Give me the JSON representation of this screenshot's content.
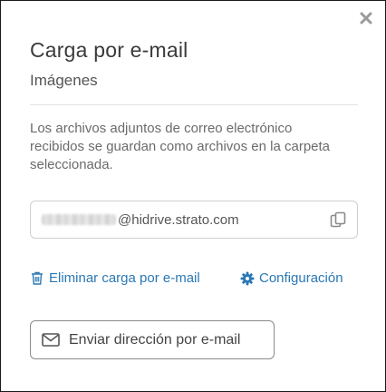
{
  "dialog": {
    "title": "Carga por e-mail",
    "subtitle": "Imágenes",
    "description": "Los archivos adjuntos de correo electrónico recibidos se guardan como archivos en la carpeta seleccionada.",
    "close_icon": "close-icon"
  },
  "email": {
    "domain": "@hidrive.strato.com",
    "copy_icon": "copy-icon"
  },
  "actions": {
    "delete_label": "Eliminar carga por e-mail",
    "delete_icon": "trash-icon",
    "config_label": "Configuración",
    "config_icon": "gear-icon"
  },
  "send_button": {
    "label": "Enviar dirección por e-mail",
    "icon": "envelope-icon"
  },
  "colors": {
    "link": "#2a78b5",
    "title": "#3a3a3a",
    "border": "#1a1a1a"
  }
}
